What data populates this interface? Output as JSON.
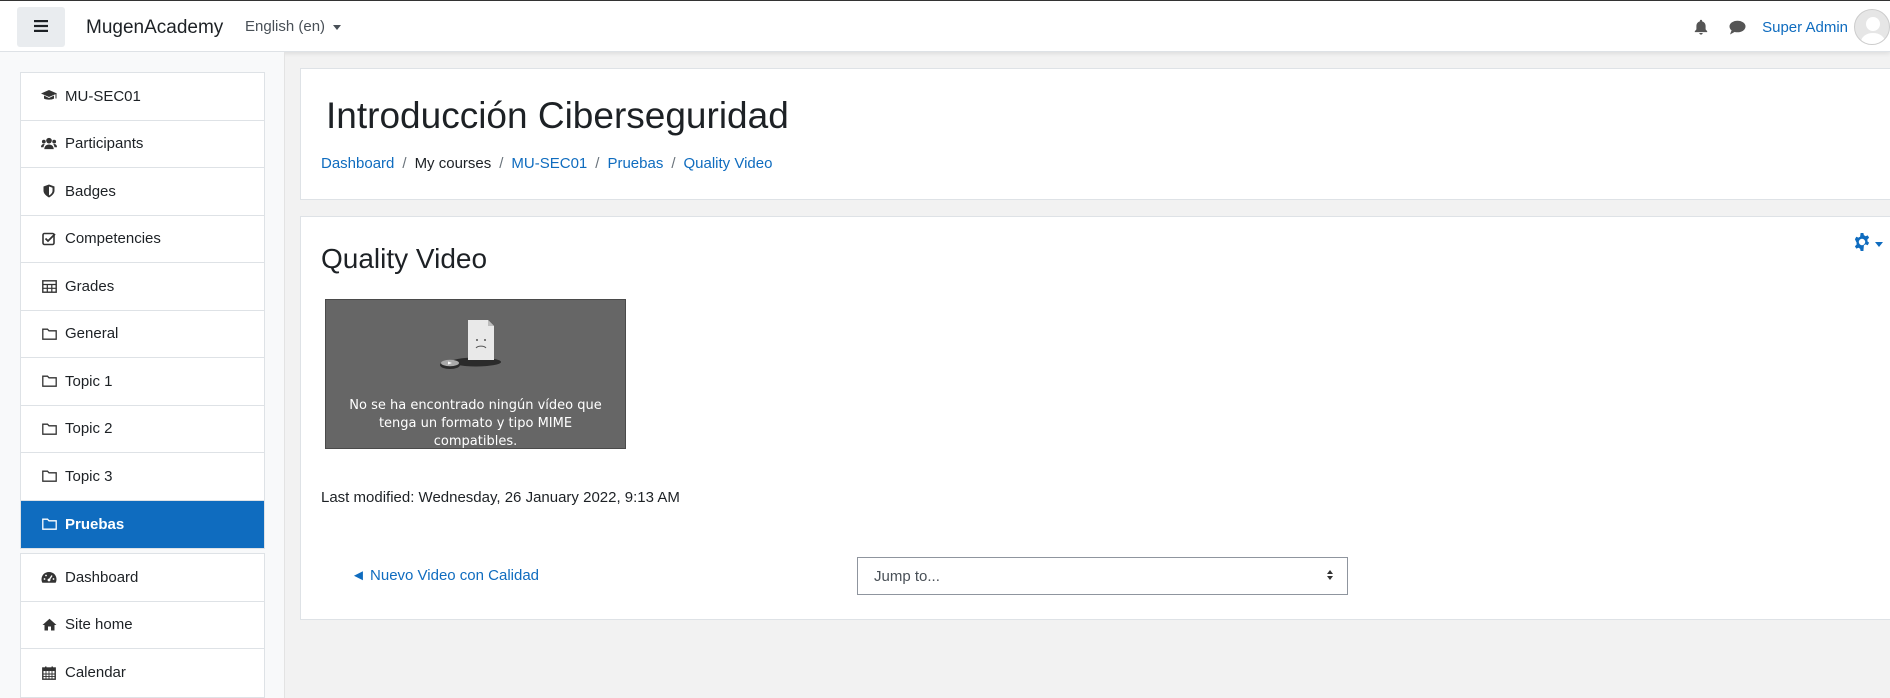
{
  "navbar": {
    "brand": "MugenAcademy",
    "language": "English ‎(en)‎",
    "user_name": "Super Admin",
    "icons": [
      "menu-icon",
      "bell-icon",
      "chat-icon",
      "avatar"
    ]
  },
  "drawer": {
    "course_items": [
      {
        "label": "MU-SEC01",
        "icon": "graduation-cap-icon"
      },
      {
        "label": "Participants",
        "icon": "users-icon"
      },
      {
        "label": "Badges",
        "icon": "shield-icon"
      },
      {
        "label": "Competencies",
        "icon": "checkbox-icon"
      },
      {
        "label": "Grades",
        "icon": "table-icon"
      },
      {
        "label": "General",
        "icon": "folder-icon"
      },
      {
        "label": "Topic 1",
        "icon": "folder-icon"
      },
      {
        "label": "Topic 2",
        "icon": "folder-icon"
      },
      {
        "label": "Topic 3",
        "icon": "folder-icon"
      },
      {
        "label": "Pruebas",
        "icon": "folder-icon",
        "active": true
      }
    ],
    "site_items": [
      {
        "label": "Dashboard",
        "icon": "dashboard-icon"
      },
      {
        "label": "Site home",
        "icon": "home-icon"
      },
      {
        "label": "Calendar",
        "icon": "calendar-icon"
      }
    ]
  },
  "header": {
    "title": "Introducción Ciberseguridad",
    "breadcrumb": [
      "Dashboard",
      "My courses",
      "MU-SEC01",
      "Pruebas",
      "Quality Video"
    ]
  },
  "content": {
    "title": "Quality Video",
    "video_error": "No se ha encontrado ningún vídeo que tenga un formato y tipo MIME compatibles.",
    "last_modified": "Last modified: Wednesday, 26 January 2022, 9:13 AM",
    "prev_link": "◄ Nuevo Video con Calidad",
    "jump_to": "Jump to..."
  },
  "colors": {
    "accent": "#0f6cbf",
    "video_bg": "#666666"
  }
}
